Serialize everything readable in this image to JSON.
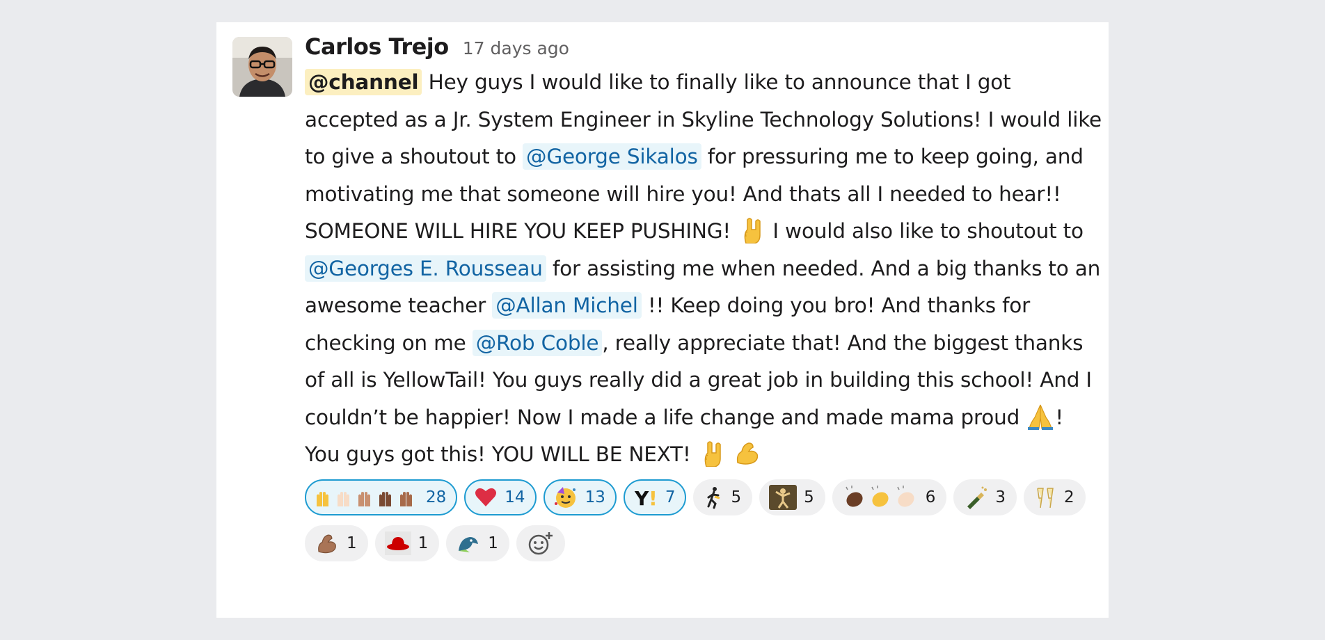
{
  "message": {
    "author": "Carlos Trejo",
    "timestamp": "17 days ago",
    "segments": {
      "channel": "@channel",
      "t1": " Hey guys I would like to finally like to announce that I got accepted as a Jr. System Engineer in Skyline Technology Solutions! I would like to give a shoutout to ",
      "m1": "@George Sikalos",
      "t2": " for pressuring me to keep going, and motivating me that someone will hire you! And thats all I needed to hear!! SOMEONE WILL HIRE YOU KEEP PUSHING! ",
      "t3": " I would also like to shoutout to ",
      "m2": "@Georges E. Rousseau",
      "t4": " for assisting me when needed. And a big thanks to an awesome teacher ",
      "m3": "@Allan Michel",
      "t5": " !! Keep doing you bro! And thanks for checking on me ",
      "m4": "@Rob Coble",
      "t6": ", really appreciate that! And the biggest thanks of all is YellowTail! You guys really did a great job in building this school! And I couldn’t be happier! Now I made a life change and made mama proud ",
      "t7": "! You guys got this! YOU WILL BE NEXT! "
    }
  },
  "reactions": [
    {
      "icon": "raised-hands-skin-tones-icon",
      "count": "28",
      "active": true
    },
    {
      "icon": "red-heart-icon",
      "count": "14",
      "active": true
    },
    {
      "icon": "partying-face-icon",
      "count": "13",
      "active": true
    },
    {
      "icon": "yellowtail-logo-icon",
      "count": "7",
      "active": true
    },
    {
      "icon": "running-figure-icon",
      "count": "5",
      "active": false
    },
    {
      "icon": "dancing-figure-icon",
      "count": "5",
      "active": false
    },
    {
      "icon": "clapping-hands-skin-tones-icon",
      "count": "6",
      "active": false
    },
    {
      "icon": "champagne-bottle-icon",
      "count": "3",
      "active": false
    },
    {
      "icon": "clinking-glasses-icon",
      "count": "2",
      "active": false
    },
    {
      "icon": "flexed-biceps-icon",
      "count": "1",
      "active": false
    },
    {
      "icon": "red-hat-icon",
      "count": "1",
      "active": false
    },
    {
      "icon": "bird-icon",
      "count": "1",
      "active": false
    }
  ],
  "colors": {
    "mention_text": "#1264a3",
    "mention_bg": "#e8f5fa",
    "channel_bg": "#fcefc0",
    "reaction_active_border": "#1d9bd1"
  }
}
